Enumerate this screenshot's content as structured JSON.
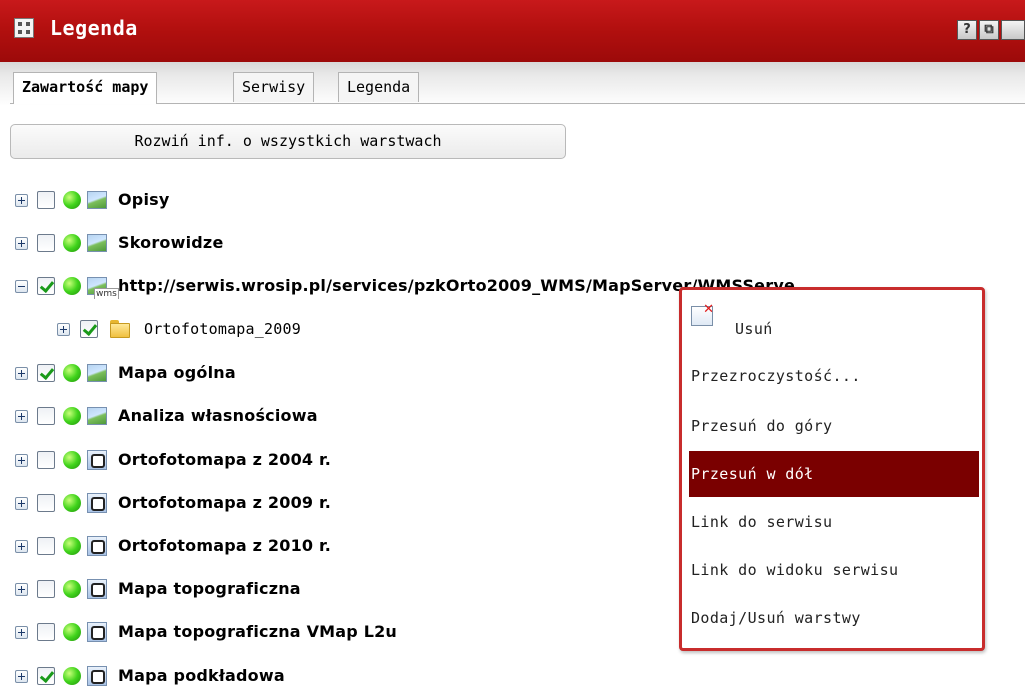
{
  "window": {
    "title": "Legenda",
    "help_btn": "?",
    "restore_btn": "⧉"
  },
  "tabs": [
    "Zawartość mapy",
    "Serwisy",
    "Legenda"
  ],
  "expand_all_label": "Rozwiń inf. o wszystkich warstwach",
  "layers": [
    {
      "label": "Opisy",
      "checked": false,
      "icon": "image-icon"
    },
    {
      "label": "Skorowidze",
      "checked": false,
      "icon": "image-icon"
    },
    {
      "label": "http://serwis.wrosip.pl/services/pzkOrto2009_WMS/MapServer/WMSServe",
      "checked": true,
      "icon": "wms-icon",
      "expanded": true
    },
    {
      "label": "Ortofotomapa_2009",
      "checked": true,
      "icon": "folder-icon",
      "child": true
    },
    {
      "label": "Mapa ogólna",
      "checked": true,
      "icon": "image-icon"
    },
    {
      "label": "Analiza własnościowa",
      "checked": false,
      "icon": "image-icon"
    },
    {
      "label": "Ortofotomapa z 2004 r.",
      "checked": false,
      "icon": "g-service-icon"
    },
    {
      "label": "Ortofotomapa z 2009 r.",
      "checked": false,
      "icon": "g-service-icon"
    },
    {
      "label": "Ortofotomapa z 2010 r.",
      "checked": false,
      "icon": "g-service-icon"
    },
    {
      "label": "Mapa topograficzna",
      "checked": false,
      "icon": "g-service-icon"
    },
    {
      "label": "Mapa topograficzna VMap L2u",
      "checked": false,
      "icon": "g-service-icon"
    },
    {
      "label": "Mapa podkładowa",
      "checked": true,
      "icon": "g-service-icon"
    }
  ],
  "context_menu": {
    "items": [
      "Usuń",
      "Przezroczystość...",
      "Przesuń do góry",
      "Przesuń w dół",
      "Link do serwisu",
      "Link do widoku serwisu",
      "Dodaj/Usuń warstwy"
    ],
    "highlighted": "Przesuń w dół"
  },
  "colors": {
    "titlebar": "#b3100f",
    "menu_border": "#c82c2c",
    "menu_highlight": "#7a0000"
  }
}
